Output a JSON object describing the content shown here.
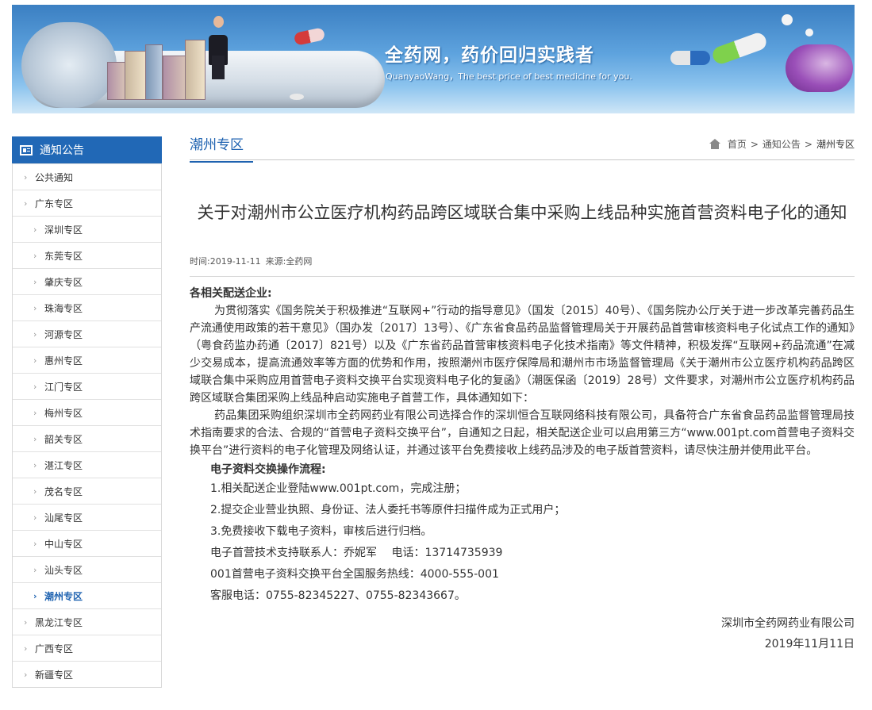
{
  "banner": {
    "slogan": "全药网，药价回归实践者",
    "slogan_en": "QuanyaoWang，The best price of best medicine for you."
  },
  "sidebar": {
    "header": "通知公告",
    "items": [
      {
        "label": "公共通知",
        "sub": false,
        "active": false
      },
      {
        "label": "广东专区",
        "sub": false,
        "active": false
      },
      {
        "label": "深圳专区",
        "sub": true,
        "active": false
      },
      {
        "label": "东莞专区",
        "sub": true,
        "active": false
      },
      {
        "label": "肇庆专区",
        "sub": true,
        "active": false
      },
      {
        "label": "珠海专区",
        "sub": true,
        "active": false
      },
      {
        "label": "河源专区",
        "sub": true,
        "active": false
      },
      {
        "label": "惠州专区",
        "sub": true,
        "active": false
      },
      {
        "label": "江门专区",
        "sub": true,
        "active": false
      },
      {
        "label": "梅州专区",
        "sub": true,
        "active": false
      },
      {
        "label": "韶关专区",
        "sub": true,
        "active": false
      },
      {
        "label": "湛江专区",
        "sub": true,
        "active": false
      },
      {
        "label": "茂名专区",
        "sub": true,
        "active": false
      },
      {
        "label": "汕尾专区",
        "sub": true,
        "active": false
      },
      {
        "label": "中山专区",
        "sub": true,
        "active": false
      },
      {
        "label": "汕头专区",
        "sub": true,
        "active": false
      },
      {
        "label": "潮州专区",
        "sub": true,
        "active": true
      },
      {
        "label": "黑龙江专区",
        "sub": false,
        "active": false
      },
      {
        "label": "广西专区",
        "sub": false,
        "active": false
      },
      {
        "label": "新疆专区",
        "sub": false,
        "active": false
      }
    ]
  },
  "main": {
    "section_title": "潮州专区",
    "breadcrumb": {
      "home": "首页",
      "parent": "通知公告",
      "current": "潮州专区"
    },
    "title": "关于对潮州市公立医疗机构药品跨区域联合集中采购上线品种实施首营资料电子化的通知",
    "meta": {
      "time_label": "时间:",
      "time": "2019-11-11",
      "source_label": "来源:",
      "source": "全药网"
    },
    "greeting": "各相关配送企业:",
    "paragraphs": [
      "为贯彻落实《国务院关于积极推进“互联网+”行动的指导意见》（国发〔2015〕40号）、《国务院办公厅关于进一步改革完善药品生产流通使用政策的若干意见》（国办发〔2017〕13号）、《广东省食品药品监督管理局关于开展药品首营审核资料电子化试点工作的通知》（粤食药监办药通〔2017〕821号）以及《广东省药品首营审核资料电子化技术指南》等文件精神，积极发挥“互联网+药品流通”在减少交易成本，提高流通效率等方面的优势和作用，按照潮州市医疗保障局和潮州市市场监督管理局《关于潮州市公立医疗机构药品跨区域联合集中采购应用首营电子资料交换平台实现资料电子化的复函》（潮医保函〔2019〕28号）文件要求，对潮州市公立医疗机构药品跨区域联合集团采购上线品种启动实施电子首营工作，具体通知如下：",
      "药品集团采购组织深圳市全药网药业有限公司选择合作的深圳恒合互联网络科技有限公司，具备符合广东省食品药品监督管理局技术指南要求的合法、合规的“首营电子资料交换平台”，自通知之日起，相关配送企业可以启用第三方“www.001pt.com首营电子资料交换平台”进行资料的电子化管理及网络认证，并通过该平台免费接收上线药品涉及的电子版首营资料，请尽快注册并使用此平台。"
    ],
    "process_title": "电子资料交换操作流程:",
    "steps": [
      "1.相关配送企业登陆www.001pt.com，完成注册；",
      "2.提交企业营业执照、身份证、法人委托书等原件扫描件成为正式用户；",
      "3.免费接收下载电子资料，审核后进行归档。",
      "电子首营技术支持联系人：乔妮军　 电话：13714735939",
      "001首营电子资料交换平台全国服务热线：4000-555-001",
      "客服电话：0755-82345227、0755-82343667。"
    ],
    "signature": "深圳市全药网药业有限公司",
    "date": "2019年11月11日"
  }
}
